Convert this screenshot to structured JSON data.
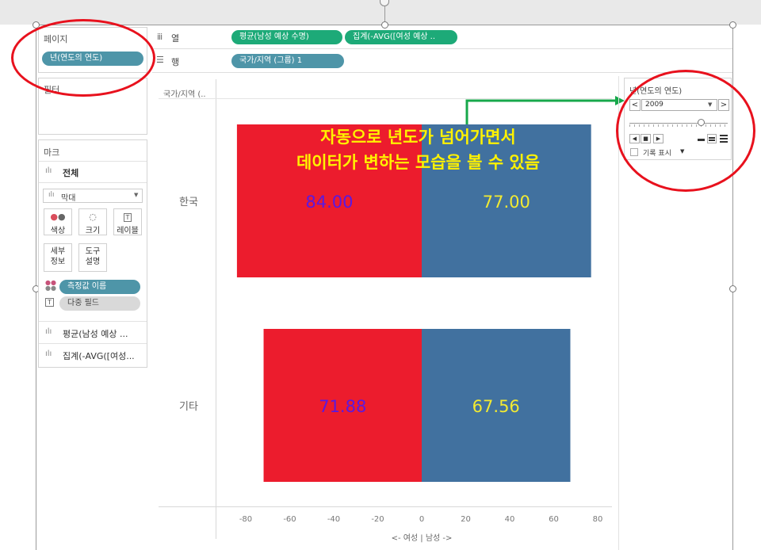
{
  "left_panel": {
    "pages_title": "페이지",
    "pages_pill": "년(연도의 연도)",
    "filters_title": "필터",
    "marks_title": "마크",
    "marks_all": "전체",
    "mark_type": "막대",
    "mark_buttons": [
      "색상",
      "크기",
      "레이블",
      "세부\n정보",
      "도구\n설명"
    ],
    "mark_fields": [
      "측정값 이름",
      "다중 필드"
    ],
    "measure_rows": [
      "평균(남성 예상 ...",
      "집계(-AVG([여성..."
    ]
  },
  "shelves": {
    "columns_label": "열",
    "columns_pills": [
      "평균(남성 예상 수명)",
      "집계(-AVG([여성 예상 .."
    ],
    "rows_label": "행",
    "rows_pills": [
      "국가/지역 (그룹) 1"
    ]
  },
  "view": {
    "row_header": "국가/지역 (..",
    "annotation_line1": "자동으로 년도가 넘어가면서",
    "annotation_line2": "데이터가 변하는 모습을 볼 수 있음"
  },
  "page_control": {
    "title": "년(연도의 연도)",
    "year": "2009",
    "show_history": "기록 표시",
    "slider_fraction": 0.72
  },
  "colors": {
    "female_bar": "#ec1c2d",
    "male_bar": "#41719f",
    "label_purple": "#5b19e0",
    "label_yellow": "#f2ea32",
    "annotation_yellow": "#fff200",
    "arrow_green": "#17a84b",
    "ellipse_red": "#e8111d"
  },
  "chart_data": {
    "type": "bar",
    "orientation": "horizontal",
    "categories": [
      "한국",
      "기타"
    ],
    "series": [
      {
        "values": [
          -84.0,
          -71.88
        ],
        "labels": [
          "84.00",
          "71.88"
        ]
      },
      {
        "values": [
          77.0,
          67.56
        ],
        "labels": [
          "77.00",
          "67.56"
        ]
      }
    ],
    "xlim": [
      -80,
      80
    ],
    "xticks": [
      "-80",
      "-60",
      "-40",
      "-20",
      "0",
      "20",
      "40",
      "60",
      "80"
    ],
    "xlabel": "<- 여성 | 남성 ->"
  }
}
